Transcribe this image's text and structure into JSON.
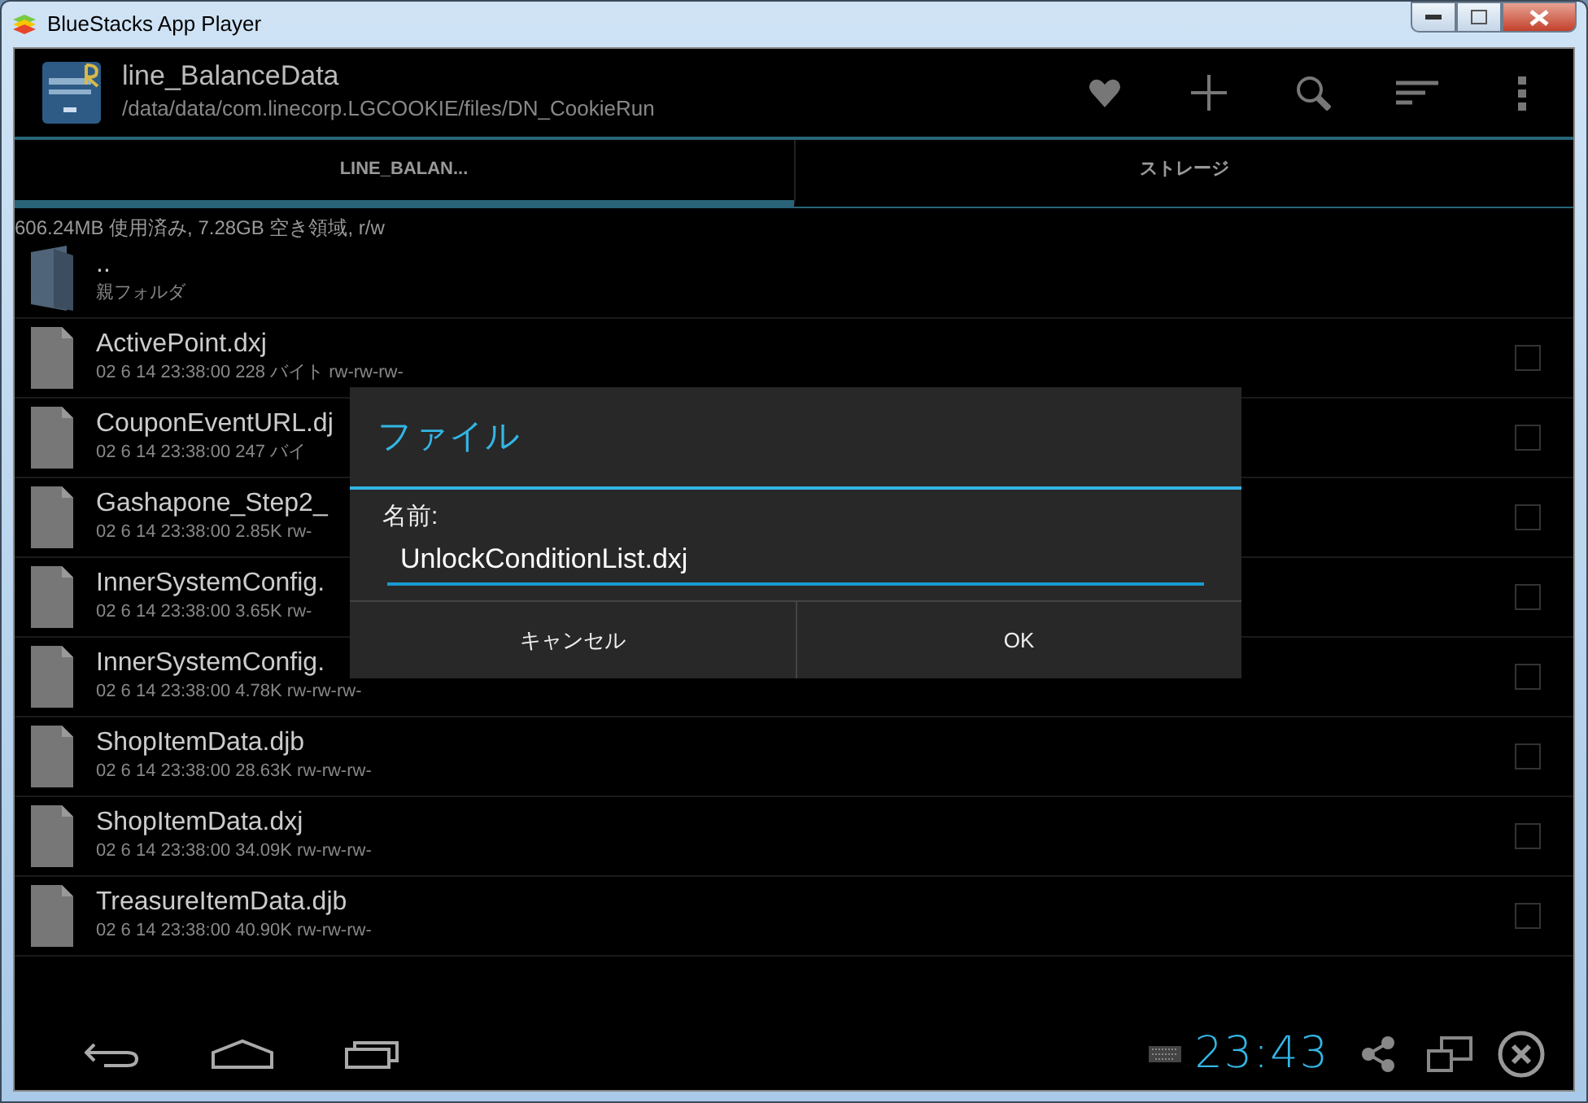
{
  "window": {
    "title": "BlueStacks App Player"
  },
  "action_bar": {
    "title": "line_BalanceData",
    "path": "/data/data/com.linecorp.LGCOOKIE/files/DN_CookieRun"
  },
  "tabs": [
    {
      "label": "LINE_BALAN...",
      "selected": true
    },
    {
      "label": "ストレージ",
      "selected": false
    }
  ],
  "storage_info": "606.24MB 使用済み, 7.28GB 空き領域, r/w",
  "parent": {
    "name": "..",
    "label": "親フォルダ"
  },
  "files": [
    {
      "name": "ActivePoint.dxj",
      "meta": "02 6 14 23:38:00  228 バイト  rw-rw-rw-",
      "checked": false
    },
    {
      "name": "CouponEventURL.dj",
      "meta": "02 6 14 23:38:00  247 バイ",
      "checked": false
    },
    {
      "name": "Gashapone_Step2_",
      "meta": "02 6 14 23:38:00  2.85K  rw-",
      "checked": false
    },
    {
      "name": "InnerSystemConfig.",
      "meta": "02 6 14 23:38:00  3.65K  rw-",
      "checked": false
    },
    {
      "name": "InnerSystemConfig.",
      "meta": "02 6 14 23:38:00  4.78K  rw-rw-rw-",
      "checked": false
    },
    {
      "name": "ShopItemData.djb",
      "meta": "02 6 14 23:38:00  28.63K  rw-rw-rw-",
      "checked": false
    },
    {
      "name": "ShopItemData.dxj",
      "meta": "02 6 14 23:38:00  34.09K  rw-rw-rw-",
      "checked": false
    },
    {
      "name": "TreasureItemData.djb",
      "meta": "02 6 14 23:38:00  40.90K  rw-rw-rw-",
      "checked": false
    }
  ],
  "dialog": {
    "title": "ファイル",
    "field_label": "名前:",
    "value": "UnlockConditionList.dxj",
    "buttons": [
      "キャンセル",
      "OK"
    ]
  },
  "nav_bar": {
    "clock": "23:43"
  }
}
